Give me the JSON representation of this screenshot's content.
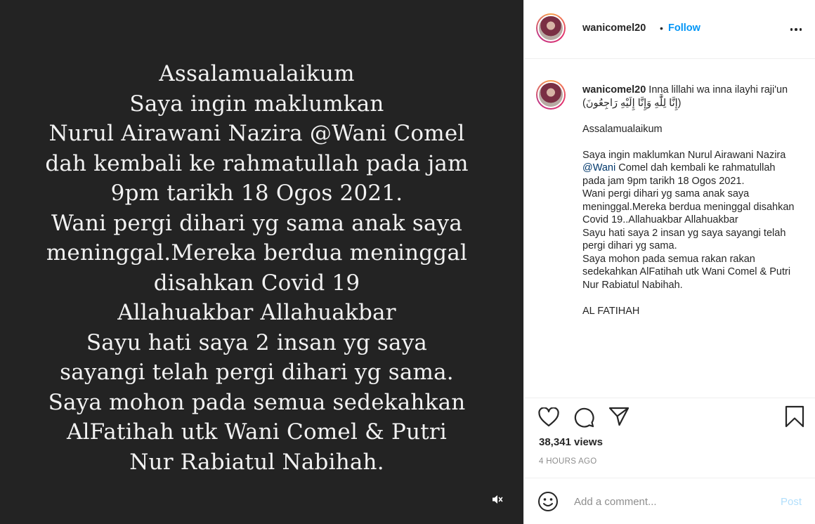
{
  "media": {
    "lines": [
      "Assalamualaikum",
      "Saya ingin maklumkan",
      "Nurul Airawani Nazira @Wani Comel",
      "dah kembali ke rahmatullah pada jam",
      "9pm tarikh 18 Ogos 2021.",
      "Wani pergi dihari yg sama anak saya",
      "meninggal.Mereka berdua meninggal",
      "disahkan Covid 19",
      "Allahuakbar Allahuakbar",
      "Sayu hati saya 2 insan yg saya",
      "sayangi telah pergi dihari yg sama.",
      "Saya mohon pada semua sedekahkan",
      "AlFatihah utk Wani Comel & Putri",
      "Nur Rabiatul Nabihah."
    ],
    "mute_icon": "speaker-muted-icon"
  },
  "header": {
    "username": "wanicomel20",
    "separator": "•",
    "follow_label": "Follow",
    "more_icon": "more-options-icon"
  },
  "caption": {
    "username": "wanicomel20",
    "intro": "Inna lillahi wa inna ilayhi raji'un (إِنَّا لِلَّٰهِ وَإِنَّا إِلَيْهِ رَاجِعُونَ)",
    "greeting": "Assalamualaikum",
    "body_before_mention": "Saya ingin maklumkan Nurul Airawani Nazira ",
    "mention": "@Wani",
    "body_after_mention": " Comel dah kembali ke rahmatullah pada jam 9pm tarikh 18 Ogos 2021.",
    "line2": "Wani pergi dihari yg sama anak saya meninggal.Mereka berdua meninggal disahkan Covid 19..Allahuakbar Allahuakbar",
    "line3": "Sayu hati saya 2 insan yg saya sayangi telah pergi dihari yg sama.",
    "line4": "Saya mohon pada semua rakan rakan sedekahkan AlFatihah utk Wani Comel & Putri Nur Rabiatul Nabihah.",
    "closing": "AL FATIHAH"
  },
  "actions": {
    "like_icon": "heart-icon",
    "comment_icon": "comment-bubble-icon",
    "share_icon": "paper-plane-icon",
    "save_icon": "bookmark-icon",
    "views": "38,341 views",
    "timestamp": "4 HOURS AGO"
  },
  "add_comment": {
    "emoji_icon": "smiley-icon",
    "placeholder": "Add a comment...",
    "post_label": "Post"
  }
}
